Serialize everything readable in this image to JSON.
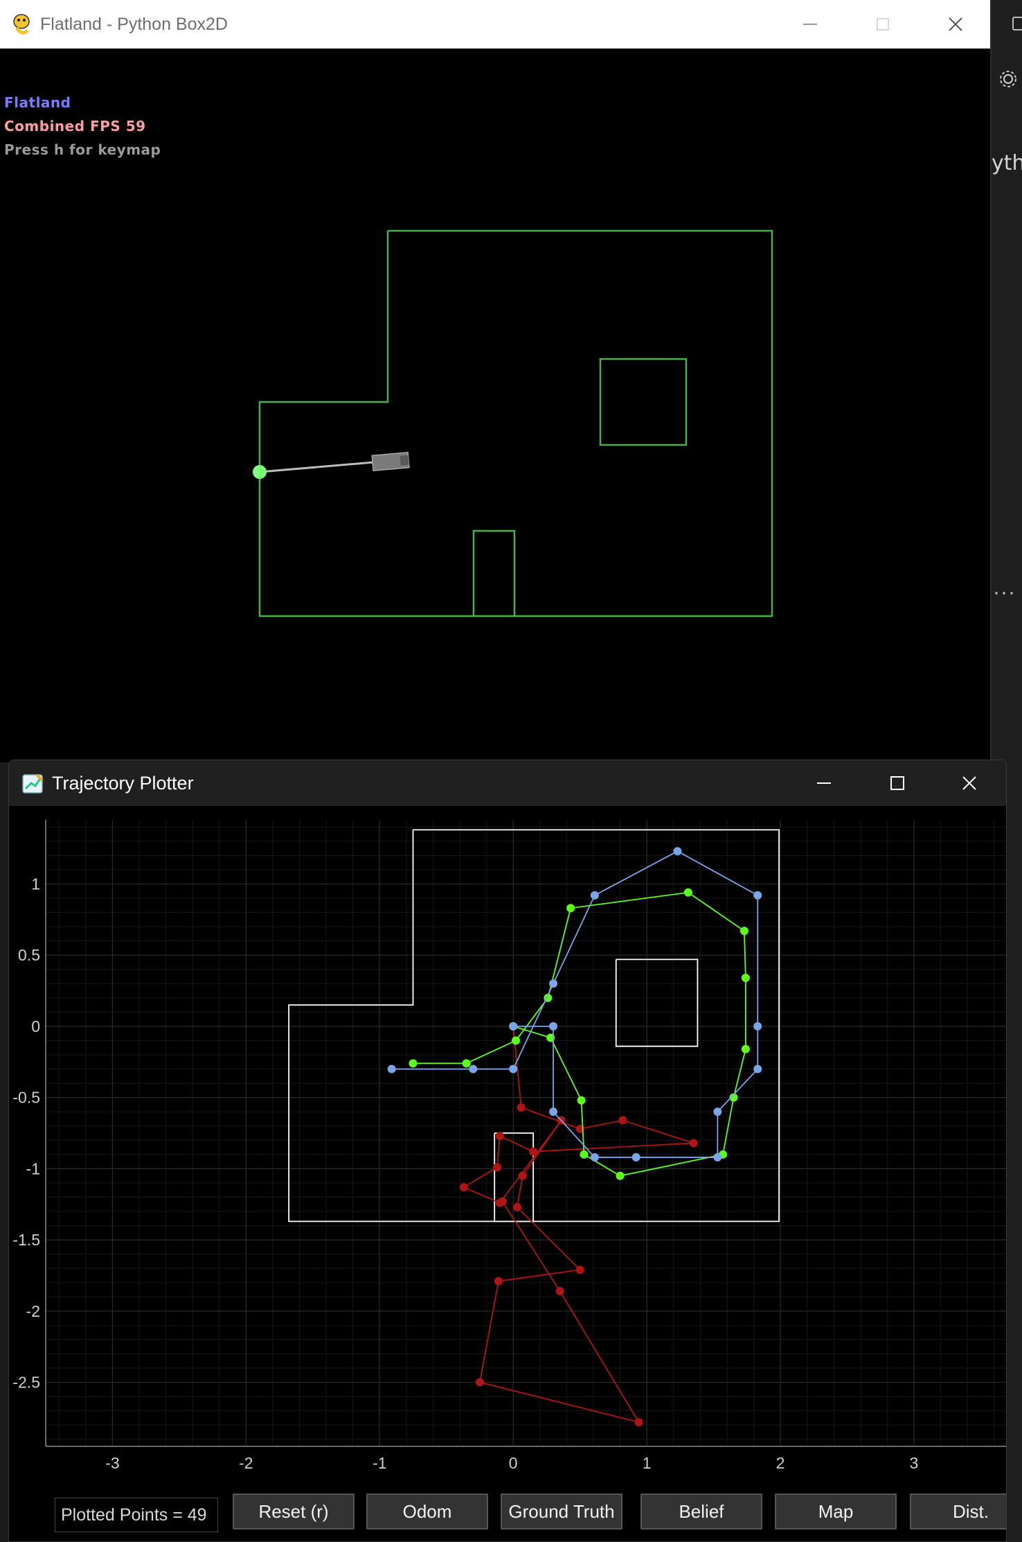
{
  "flatland": {
    "window_title": "Flatland - Python Box2D",
    "hud": {
      "line1": "Flatland",
      "line2": "Combined FPS 59",
      "line3": "Press h for keymap",
      "line1_color": "#7b7bff",
      "line2_color": "#ff9e9e",
      "line3_color": "#9a9a9a"
    },
    "wall_color": "#4caf50",
    "robot_color": "#808080",
    "laser_hit_color": "#7dff7d"
  },
  "plotter": {
    "window_title": "Trajectory Plotter",
    "points_label": "Plotted Points = 49",
    "buttons": [
      "Reset (r)",
      "Odom",
      "Ground Truth",
      "Belief",
      "Map",
      "Dist."
    ],
    "colors": {
      "odom": "#b01515",
      "ground_truth": "#5cff1a",
      "belief": "#7aa6e8",
      "map": "#ffffff",
      "grid": "#2a2a2a"
    }
  },
  "background_app": {
    "partial_text": "yth"
  },
  "chart_data": {
    "type": "line",
    "xlim": [
      -3.5,
      3.7
    ],
    "ylim": [
      -2.95,
      1.45
    ],
    "x_ticks": [
      "-3",
      "-2",
      "-1",
      "0",
      "1",
      "2",
      "3"
    ],
    "y_ticks": [
      "1",
      "0.5",
      "0",
      "-0.5",
      "-1",
      "-1.5",
      "-2",
      "-2.5"
    ],
    "grid": true,
    "map": [
      [
        [
          -0.75,
          1.38
        ],
        [
          1.99,
          1.38
        ],
        [
          1.99,
          -1.37
        ],
        [
          -1.68,
          -1.37
        ],
        [
          -1.68,
          0.15
        ],
        [
          -0.75,
          0.15
        ],
        [
          -0.75,
          1.38
        ]
      ],
      [
        [
          0.77,
          0.47
        ],
        [
          1.38,
          0.47
        ],
        [
          1.38,
          -0.14
        ],
        [
          0.77,
          -0.14
        ],
        [
          0.77,
          0.47
        ]
      ],
      [
        [
          -0.14,
          -0.75
        ],
        [
          0.15,
          -0.75
        ],
        [
          0.15,
          -1.37
        ],
        [
          -0.14,
          -1.37
        ],
        [
          -0.14,
          -0.75
        ]
      ]
    ],
    "series": [
      {
        "key": "belief",
        "values": [
          [
            -0.91,
            -0.3
          ],
          [
            -0.3,
            -0.3
          ],
          [
            0.0,
            -0.3
          ],
          [
            0.3,
            0.3
          ],
          [
            0.61,
            0.92
          ],
          [
            1.23,
            1.23
          ],
          [
            1.83,
            0.92
          ],
          [
            1.83,
            0.0
          ],
          [
            1.83,
            -0.3
          ],
          [
            1.53,
            -0.6
          ],
          [
            1.53,
            -0.92
          ],
          [
            0.92,
            -0.92
          ],
          [
            0.61,
            -0.92
          ],
          [
            0.3,
            -0.6
          ],
          [
            0.3,
            0.0
          ],
          [
            0.0,
            0.0
          ]
        ]
      },
      {
        "key": "ground_truth",
        "values": [
          [
            -0.75,
            -0.26
          ],
          [
            -0.35,
            -0.26
          ],
          [
            0.02,
            -0.1
          ],
          [
            0.26,
            0.2
          ],
          [
            0.43,
            0.83
          ],
          [
            1.31,
            0.94
          ],
          [
            1.73,
            0.67
          ],
          [
            1.74,
            0.34
          ],
          [
            1.74,
            -0.16
          ],
          [
            1.65,
            -0.5
          ],
          [
            1.57,
            -0.9
          ],
          [
            0.8,
            -1.05
          ],
          [
            0.53,
            -0.9
          ],
          [
            0.51,
            -0.52
          ],
          [
            0.28,
            -0.08
          ],
          [
            0.0,
            0.0
          ]
        ]
      },
      {
        "key": "odom",
        "values": [
          [
            0.0,
            0.0
          ],
          [
            0.06,
            -0.57
          ],
          [
            0.5,
            -0.72
          ],
          [
            0.82,
            -0.66
          ],
          [
            1.35,
            -0.82
          ],
          [
            0.15,
            -0.88
          ],
          [
            -0.1,
            -0.77
          ],
          [
            -0.12,
            -0.99
          ],
          [
            -0.37,
            -1.13
          ],
          [
            -0.1,
            -1.24
          ],
          [
            0.36,
            -0.66
          ],
          [
            0.07,
            -1.05
          ],
          [
            0.03,
            -1.27
          ],
          [
            0.5,
            -1.71
          ],
          [
            -0.11,
            -1.79
          ],
          [
            -0.25,
            -2.5
          ],
          [
            0.94,
            -2.78
          ],
          [
            0.35,
            -1.86
          ],
          [
            -0.08,
            -1.23
          ]
        ]
      }
    ]
  }
}
